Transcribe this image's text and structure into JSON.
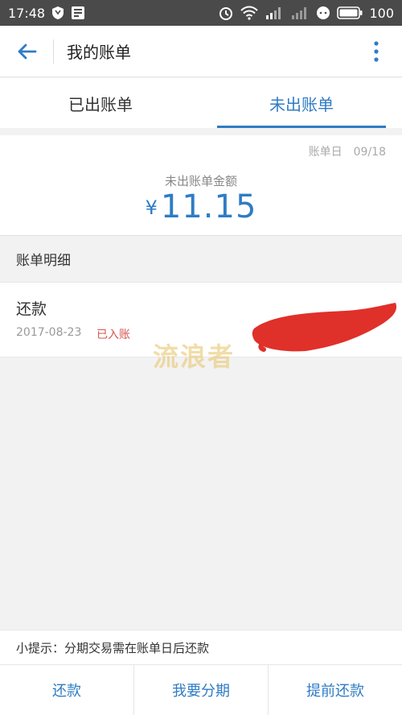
{
  "status_bar": {
    "time": "17:48",
    "battery": "100",
    "icons": [
      "shield-icon",
      "notification-icon",
      "alarm-icon",
      "wifi-icon",
      "signal-4g-icon",
      "signal-icon",
      "chat-icon",
      "battery-icon"
    ]
  },
  "header": {
    "title": "我的账单"
  },
  "tabs": [
    {
      "label": "已出账单",
      "active": false
    },
    {
      "label": "未出账单",
      "active": true
    }
  ],
  "summary": {
    "bill_day_label": "账单日",
    "bill_day": "09/18",
    "amount_label": "未出账单金额",
    "currency": "¥",
    "amount": "11.15"
  },
  "details": {
    "header": "账单明细",
    "items": [
      {
        "title": "还款",
        "date": "2017-08-23",
        "status": "已入账"
      }
    ]
  },
  "watermark": "流浪者",
  "tip": "小提示：分期交易需在账单日后还款",
  "bottom_actions": [
    "还款",
    "我要分期",
    "提前还款"
  ],
  "colors": {
    "accent": "#2f7cc4",
    "status_red": "#d9534f",
    "status_bar_bg": "#4a4a4a"
  }
}
